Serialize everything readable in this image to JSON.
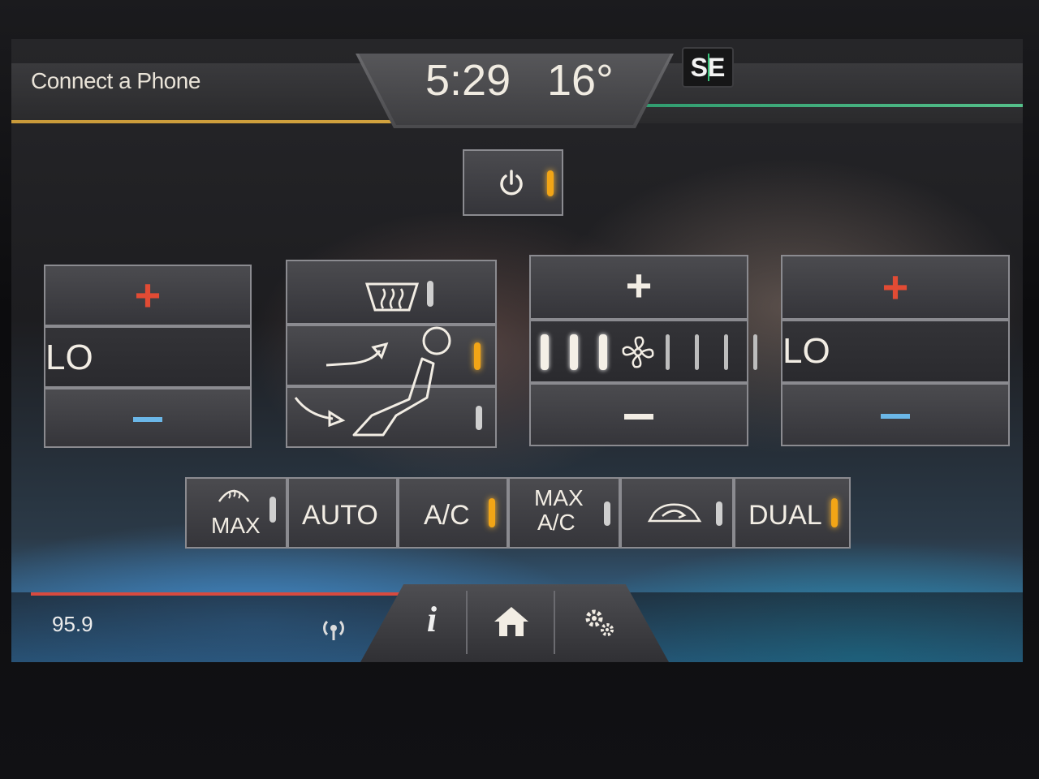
{
  "status_bar": {
    "phone_label": "Connect a Phone",
    "time": "5:29",
    "temperature": "16°",
    "compass": "SE"
  },
  "climate": {
    "power": {
      "icon": "power-icon",
      "active": true
    },
    "driver": {
      "value": "LO",
      "plus_icon": "plus-icon",
      "minus_icon": "minus-icon"
    },
    "passenger": {
      "value": "LO",
      "plus_icon": "plus-icon",
      "minus_icon": "minus-icon"
    },
    "airflow": {
      "defrost": {
        "icon": "rear-defrost-icon",
        "active": false
      },
      "panel": {
        "icon": "panel-vent-icon",
        "active": true
      },
      "floor": {
        "icon": "floor-vent-icon",
        "active": false
      }
    },
    "fan": {
      "level": 3,
      "max_level": 7,
      "icon": "fan-icon"
    },
    "bottom_buttons": {
      "max_defrost": "MAX",
      "auto": "AUTO",
      "ac": "A/C",
      "max_ac_top": "MAX",
      "max_ac_bottom": "A/C",
      "recirculate": "recirculate-icon",
      "dual": "DUAL"
    },
    "indicators": {
      "max_defrost": false,
      "ac": true,
      "max_ac": false,
      "recirculate": false,
      "dual": true
    }
  },
  "footer": {
    "radio_frequency": "95.9",
    "nav": [
      "info-icon",
      "home-icon",
      "settings-icon"
    ]
  },
  "colors": {
    "indicator_on": "#f2a516",
    "plus_red": "#e14b34",
    "minus_blue": "#6bb7e8",
    "accent_orange": "#d2a23e",
    "accent_green": "#55c08a"
  }
}
